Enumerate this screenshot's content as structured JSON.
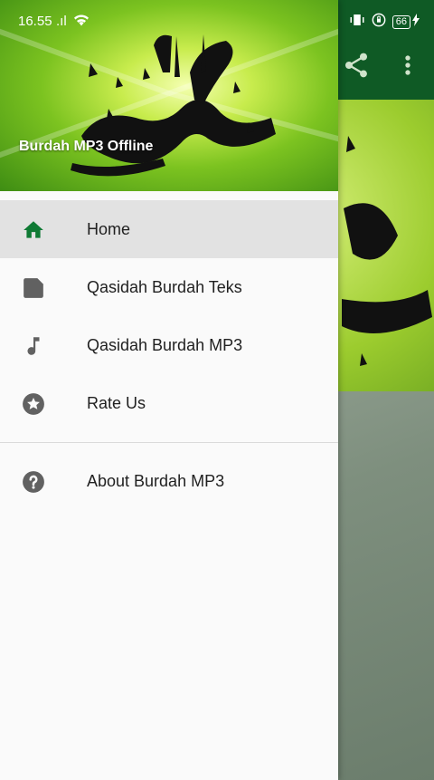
{
  "status_bar": {
    "time": "16.55",
    "signal": ".ıl",
    "battery": "66"
  },
  "drawer": {
    "header_title": "Burdah MP3 Offline",
    "items": [
      {
        "label": "Home",
        "icon": "home-icon",
        "active": true
      },
      {
        "label": "Qasidah Burdah Teks",
        "icon": "file-icon",
        "active": false
      },
      {
        "label": "Qasidah Burdah MP3",
        "icon": "music-note-icon",
        "active": false
      },
      {
        "label": "Rate Us",
        "icon": "star-circle-icon",
        "active": false
      }
    ],
    "secondary_items": [
      {
        "label": "About Burdah MP3",
        "icon": "help-circle-icon",
        "active": false
      }
    ]
  },
  "toolbar_actions": [
    "share-icon",
    "more-vert-icon"
  ],
  "colors": {
    "accent": "#0f7a34",
    "toolbar": "#0f5a25",
    "icon_gray": "#616161",
    "active_bg": "#e2e2e2"
  }
}
